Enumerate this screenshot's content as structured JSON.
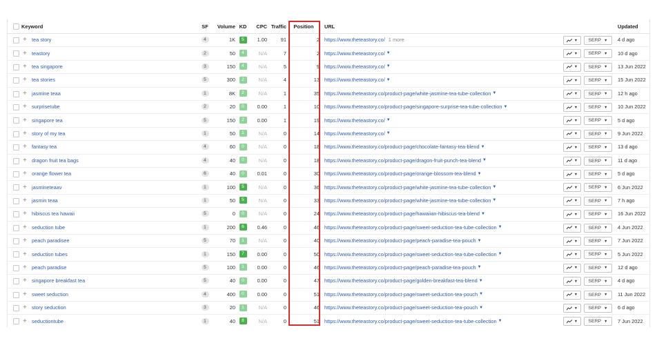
{
  "headers": {
    "keyword": "Keyword",
    "sf": "SF",
    "volume": "Volume",
    "kd": "KD",
    "cpc": "CPC",
    "traffic": "Traffic",
    "position": "Position",
    "url": "URL",
    "updated": "Updated"
  },
  "serp_label": "SERP",
  "colors": {
    "kd_green_light": "#8fd29a",
    "kd_green": "#4caf50",
    "highlight_border": "#d32f2f",
    "link": "#2f5db0"
  },
  "rows": [
    {
      "keyword": "tea story",
      "sf": "4",
      "volume": "1K",
      "kd": "5",
      "cpc": "1.00",
      "traffic": "91",
      "position": "2",
      "url": "https://www.theteastory.co/",
      "more": "1 more",
      "updated": "4 d ago"
    },
    {
      "keyword": "teastory",
      "sf": "2",
      "volume": "50",
      "kd": "4",
      "cpc": "N/A",
      "traffic": "7",
      "position": "2",
      "url": "https://www.theteastory.co/",
      "updated": "10 d ago"
    },
    {
      "keyword": "tea singapore",
      "sf": "3",
      "volume": "150",
      "kd": "4",
      "cpc": "N/A",
      "traffic": "5",
      "position": "9",
      "url": "https://www.theteastory.co/",
      "updated": "13 Jun 2022"
    },
    {
      "keyword": "tea stories",
      "sf": "5",
      "volume": "300",
      "kd": "2",
      "cpc": "N/A",
      "traffic": "4",
      "position": "13",
      "url": "https://www.theteastory.co/",
      "updated": "15 Jun 2022"
    },
    {
      "keyword": "jasmine teaa",
      "sf": "1",
      "volume": "8K",
      "kd": "2",
      "cpc": "N/A",
      "traffic": "1",
      "position": "35",
      "url": "https://www.theteastory.co/product-page/white-jasmine-tea-tube-collection",
      "updated": "12 h ago"
    },
    {
      "keyword": "surprisetube",
      "sf": "2",
      "volume": "20",
      "kd": "0",
      "cpc": "0.00",
      "traffic": "1",
      "position": "10",
      "url": "https://www.theteastory.co/product-page/singapore-surprise-tea-tube-collection",
      "updated": "10 Jun 2022"
    },
    {
      "keyword": "singapore tea",
      "sf": "5",
      "volume": "150",
      "kd": "2",
      "cpc": "0.00",
      "traffic": "1",
      "position": "19",
      "url": "https://www.theteastory.co/",
      "updated": "5 d ago"
    },
    {
      "keyword": "story of my tea",
      "sf": "1",
      "volume": "50",
      "kd": "1",
      "cpc": "N/A",
      "traffic": "0",
      "position": "14",
      "url": "https://www.theteastory.co/",
      "updated": "9 Jun 2022"
    },
    {
      "keyword": "fantasy tea",
      "sf": "4",
      "volume": "60",
      "kd": "0",
      "cpc": "N/A",
      "traffic": "0",
      "position": "18",
      "url": "https://www.theteastory.co/product-page/chocolate-fantasy-tea-blend",
      "updated": "13 d ago"
    },
    {
      "keyword": "dragon fruit tea bags",
      "sf": "4",
      "volume": "40",
      "kd": "0",
      "cpc": "N/A",
      "traffic": "0",
      "position": "18",
      "url": "https://www.theteastory.co/product-page/dragon-fruit-punch-tea-blend",
      "updated": "11 d ago"
    },
    {
      "keyword": "orange flower tea",
      "sf": "6",
      "volume": "40",
      "kd": "0",
      "cpc": "0.01",
      "traffic": "0",
      "position": "30",
      "url": "https://www.theteastory.co/product-page/orange-blossom-tea-blend",
      "updated": "5 d ago"
    },
    {
      "keyword": "jasmineteaav",
      "sf": "1",
      "volume": "100",
      "kd": "5",
      "cpc": "N/A",
      "traffic": "0",
      "position": "36",
      "url": "https://www.theteastory.co/product-page/white-jasmine-tea-tube-collection",
      "updated": "6 Jun 2022"
    },
    {
      "keyword": "jasmin teaa",
      "sf": "1",
      "volume": "50",
      "kd": "5",
      "cpc": "N/A",
      "traffic": "0",
      "position": "33",
      "url": "https://www.theteastory.co/product-page/white-jasmine-tea-tube-collection",
      "updated": "7 h ago"
    },
    {
      "keyword": "hibiscus tea hawaii",
      "sf": "5",
      "volume": "0",
      "kd": "0",
      "cpc": "N/A",
      "traffic": "0",
      "position": "24",
      "url": "https://www.theteastory.co/product-page/hawaiian-hibiscus-tea-blend",
      "updated": "16 Jun 2022"
    },
    {
      "keyword": "seduction tube",
      "sf": "1",
      "volume": "200",
      "kd": "6",
      "cpc": "0.46",
      "traffic": "0",
      "position": "46",
      "url": "https://www.theteastory.co/product-page/sweet-seduction-tea-tube-collection",
      "updated": "4 Jun 2022"
    },
    {
      "keyword": "peach paradisee",
      "sf": "5",
      "volume": "70",
      "kd": "1",
      "cpc": "N/A",
      "traffic": "0",
      "position": "40",
      "url": "https://www.theteastory.co/product-page/peach-paradise-tea-pouch",
      "updated": "7 Jun 2022"
    },
    {
      "keyword": "seduction tubes",
      "sf": "1",
      "volume": "150",
      "kd": "7",
      "cpc": "0.00",
      "traffic": "0",
      "position": "50",
      "url": "https://www.theteastory.co/product-page/sweet-seduction-tea-tube-collection",
      "updated": "5 Jun 2022"
    },
    {
      "keyword": "peach paradise",
      "sf": "5",
      "volume": "100",
      "kd": "1",
      "cpc": "0.00",
      "traffic": "0",
      "position": "46",
      "url": "https://www.theteastory.co/product-page/peach-paradise-tea-pouch",
      "updated": "12 d ago"
    },
    {
      "keyword": "singapore breakfast tea",
      "sf": "5",
      "volume": "40",
      "kd": "0",
      "cpc": "0.00",
      "traffic": "0",
      "position": "47",
      "url": "https://www.theteastory.co/product-page/golden-breakfast-tea-blend",
      "updated": "4 d ago"
    },
    {
      "keyword": "sweet seduction",
      "sf": "4",
      "volume": "400",
      "kd": "0",
      "cpc": "0.00",
      "traffic": "0",
      "position": "51",
      "url": "https://www.theteastory.co/product-page/sweet-seduction-tea-pouch",
      "updated": "11 Jun 2022"
    },
    {
      "keyword": "story seduction",
      "sf": "3",
      "volume": "20",
      "kd": "1",
      "cpc": "N/A",
      "traffic": "0",
      "position": "46",
      "url": "https://www.theteastory.co/product-page/sweet-seduction-tea-pouch",
      "updated": "6 d ago"
    },
    {
      "keyword": "seductiontube",
      "sf": "1",
      "volume": "40",
      "kd": "8",
      "cpc": "N/A",
      "traffic": "0",
      "position": "51",
      "url": "https://www.theteastory.co/product-page/sweet-seduction-tea-tube-collection",
      "updated": "7 Jun 2022"
    }
  ]
}
